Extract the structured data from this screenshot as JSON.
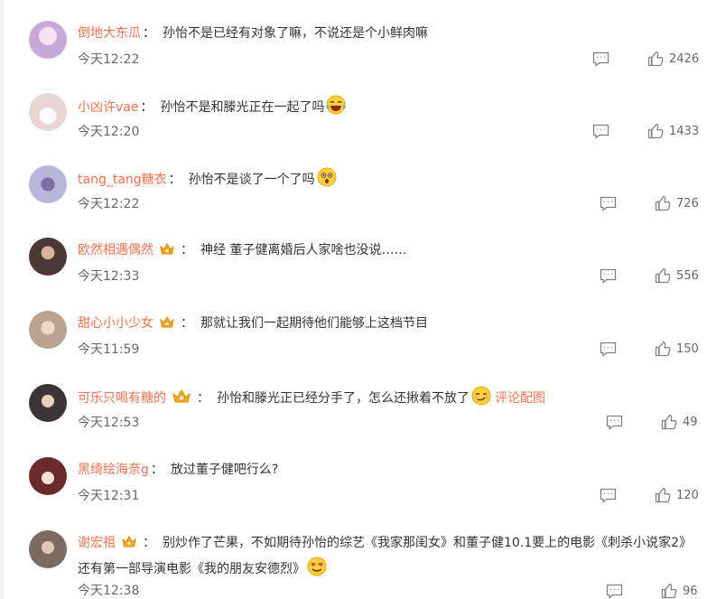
{
  "comments": [
    {
      "user": "倒地大东瓜",
      "text": "孙怡不是已经有对象了嘛，不说还是个小鲜肉嘛",
      "time": "今天12:22",
      "likes": "2426",
      "has_badge": false,
      "emoji": "",
      "avatar_color": "#c7a9d8"
    },
    {
      "user": "小凶许vae",
      "text": "孙怡不是和滕光正在一起了吗",
      "time": "今天12:20",
      "likes": "1433",
      "has_badge": false,
      "emoji": "laughing-tears",
      "avatar_color": "#e8d6d2"
    },
    {
      "user": "tang_tang糖衣",
      "text": "孙怡不是谈了一个了吗",
      "time": "今天12:22",
      "likes": "726",
      "has_badge": false,
      "emoji": "shocked",
      "avatar_color": "#b7b6d8"
    },
    {
      "user": "欧然相遇偶然",
      "text": "神经 董子健离婚后人家啥也没说……",
      "time": "今天12:33",
      "likes": "556",
      "has_badge": true,
      "emoji": "",
      "avatar_color": "#4a3a33"
    },
    {
      "user": "甜心小小少女",
      "text": "那就让我们一起期待他们能够上这档节目",
      "time": "今天11:59",
      "likes": "150",
      "has_badge": true,
      "emoji": "",
      "avatar_color": "#b9a28e"
    },
    {
      "user": "可乐只喝有糖的",
      "text": "孙怡和滕光正已经分手了，怎么还揪着不放了",
      "time": "今天12:53",
      "likes": "49",
      "has_badge": true,
      "emoji": "smirk",
      "link": "评论配图",
      "avatar_color": "#3d3535"
    },
    {
      "user": "黑绮绘海奈g",
      "text": "放过董子健吧行么?",
      "time": "今天12:31",
      "likes": "120",
      "has_badge": false,
      "emoji": "",
      "avatar_color": "#6b2b2b"
    },
    {
      "user": "谢宏祖",
      "text": "别炒作了芒果，不如期待孙怡的综艺《我家那闺女》和董子健10.1要上的电影《刺杀小说家2》还有第一部导演电影《我的朋友安德烈》",
      "time": "今天12:38",
      "likes": "96",
      "has_badge": true,
      "emoji": "heart-eyes",
      "avatar_color": "#7a6a60"
    }
  ],
  "icons": {
    "reply": "comment-icon",
    "like": "thumbs-up-icon",
    "badge": "crown-badge-icon"
  },
  "colors": {
    "username": "#eb7350",
    "text": "#333333",
    "meta": "#666666"
  }
}
